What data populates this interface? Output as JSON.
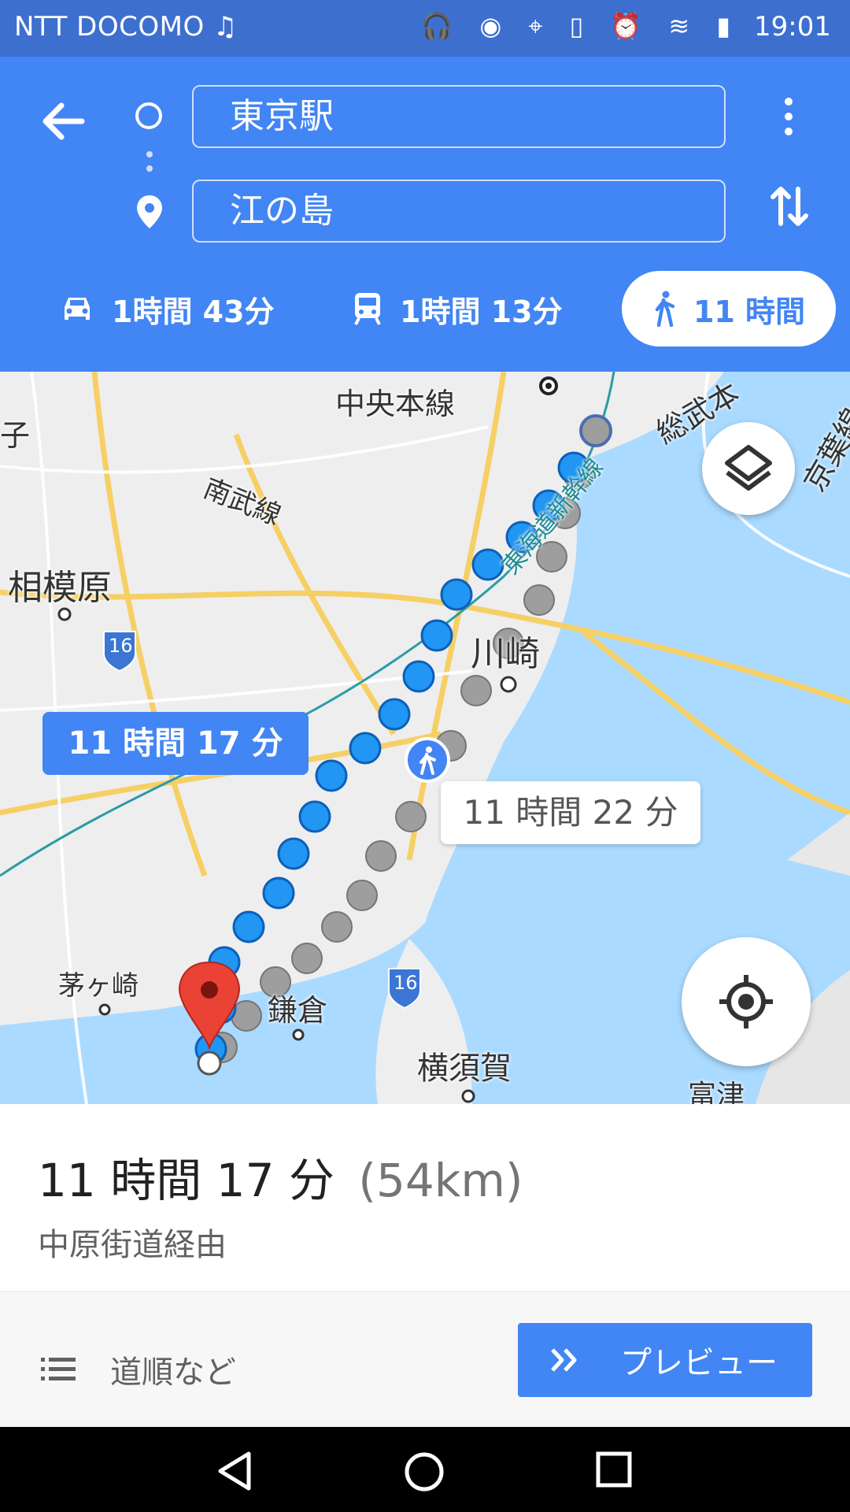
{
  "status_bar": {
    "carrier": "NTT DOCOMO ♫ ",
    "icons": [
      "headphones-icon",
      "data-icon",
      "location-icon",
      "vibrate-icon",
      "alarm-icon",
      "wifi-icon",
      "signal-icon",
      "battery-icon"
    ],
    "icon_glyphs": "🎧 ◉ ⌖ ▯ ⏰ ≋ ▮",
    "time": "19:01"
  },
  "header": {
    "origin": "東京駅",
    "destination": "江の島",
    "modes": [
      {
        "name": "car",
        "label": "1時間 43分"
      },
      {
        "name": "transit",
        "label": "1時間 13分"
      },
      {
        "name": "walk",
        "label": "11 時間",
        "selected": true
      }
    ]
  },
  "map": {
    "place_labels": [
      "中央本線",
      "総武本",
      "京葉線",
      "子",
      "南武線",
      "相模原",
      "東海道新幹線",
      "川崎",
      "茅ヶ崎",
      "鎌倉",
      "横須賀",
      "富津"
    ],
    "route_badges": [
      "16",
      "16"
    ],
    "route_bubbles": {
      "selected": "11 時間 17 分",
      "alternative": "11 時間 22 分"
    }
  },
  "summary": {
    "duration": "11 時間 17 分",
    "distance": "(54km)",
    "via": "中原街道経由"
  },
  "actions": {
    "steps_label": "道順など",
    "preview_label": "プレビュー"
  },
  "colors": {
    "status_bar": "#3d6fcf",
    "header": "#4285f4",
    "route_blue": "#2196f3",
    "route_gray": "#9e9e9e",
    "water": "#aadaff",
    "land": "#eeeeee",
    "pin": "#ea4335"
  }
}
